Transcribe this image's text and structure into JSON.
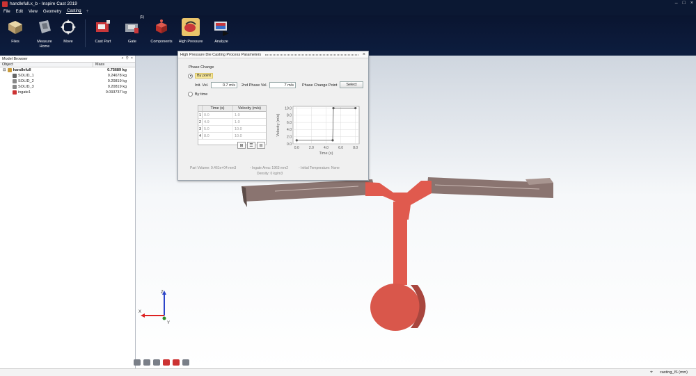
{
  "window": {
    "title": "handlefull.x_b - Inspire Cast 2019",
    "controls": [
      "–",
      "□",
      "×"
    ]
  },
  "menu": {
    "items": [
      "File",
      "Edit",
      "View",
      "Geometry",
      "Casting"
    ],
    "active": "Casting",
    "plus": "+"
  },
  "ribbon": {
    "tools": [
      {
        "label": "Files"
      },
      {
        "label": "Measure\nHome"
      },
      {
        "label": "Move"
      },
      {
        "label": "Cast Part"
      },
      {
        "label": "Gate",
        "badge": "(1)"
      },
      {
        "label": "Components"
      },
      {
        "label": "High Pressure"
      },
      {
        "label": "Analyze"
      }
    ]
  },
  "model_browser": {
    "title": "Model Browser",
    "icons": [
      "⌕",
      "⚲",
      "×"
    ],
    "columns": {
      "object": "Object",
      "mass": "Mass"
    },
    "rows": [
      {
        "name": "handlefull",
        "mass": "0.75689 kg",
        "bold": true,
        "indent": 0,
        "icon": "assembly-icon"
      },
      {
        "name": "SOLID_1",
        "mass": "0.24678 kg",
        "bold": false,
        "indent": 1,
        "icon": "cast-part-icon"
      },
      {
        "name": "SOLID_2",
        "mass": "0.20819 kg",
        "bold": false,
        "indent": 1,
        "icon": "solid-icon"
      },
      {
        "name": "SOLID_3",
        "mass": "0.20819 kg",
        "bold": false,
        "indent": 1,
        "icon": "solid-icon"
      },
      {
        "name": "ingate1",
        "mass": "0.093737 kg",
        "bold": false,
        "indent": 1,
        "icon": "ingate-icon"
      }
    ]
  },
  "dialog": {
    "title": "High Pressure Die Casting Process Parameters",
    "close": "×",
    "section": "Phase Change",
    "radio_by_point": "By point",
    "radio_by_time": "By time",
    "init_vel_label": "Init. Vel.",
    "init_vel_value": "0.7 m/s",
    "second_vel_label": "2nd Phase Vel.",
    "second_vel_value": "7 m/s",
    "phase_change_label": "Phase Change Point",
    "select_label": "Select",
    "table": {
      "headers": [
        "Time (s)",
        "Velocity (m/s)"
      ],
      "rows": [
        {
          "idx": "1",
          "time": "0.0",
          "vel": "1.0"
        },
        {
          "idx": "2",
          "time": "4.9",
          "vel": "1.0"
        },
        {
          "idx": "3",
          "time": "5.0",
          "vel": "10.0"
        },
        {
          "idx": "4",
          "time": "8.0",
          "vel": "10.0"
        }
      ],
      "buttons": [
        "⊞",
        "☰",
        "⊟"
      ]
    },
    "info": {
      "part_volume": "Part Volume:   9.461e+04 mm3",
      "ingate_area": "- Ingate Area:    1963 mm2",
      "initial_temp": "- Initial Temperature:    None",
      "density": "Density:    0 kg/m3"
    }
  },
  "chart_data": {
    "type": "line",
    "x": [
      0.0,
      4.9,
      5.0,
      8.0
    ],
    "values": [
      1.0,
      1.0,
      10.0,
      10.0
    ],
    "xlabel": "Time (s)",
    "ylabel": "Velocity (m/s)",
    "xlim": [
      -0.5,
      8.5
    ],
    "ylim": [
      0,
      10.5
    ],
    "xticks": [
      "0.0",
      "2.0",
      "4.0",
      "6.0",
      "8.0"
    ],
    "yticks": [
      "0.0",
      "2.0",
      "4.0",
      "6.0",
      "8.0",
      "10.0"
    ],
    "grid": true,
    "color": "#555555"
  },
  "triad": {
    "z": "Z",
    "x": "X",
    "y": "Y"
  },
  "status": {
    "units": "casting_IS (mm)"
  },
  "colors": {
    "part": "#8a7470",
    "runner": "#e05a4e",
    "biscuit": "#d9574b"
  }
}
